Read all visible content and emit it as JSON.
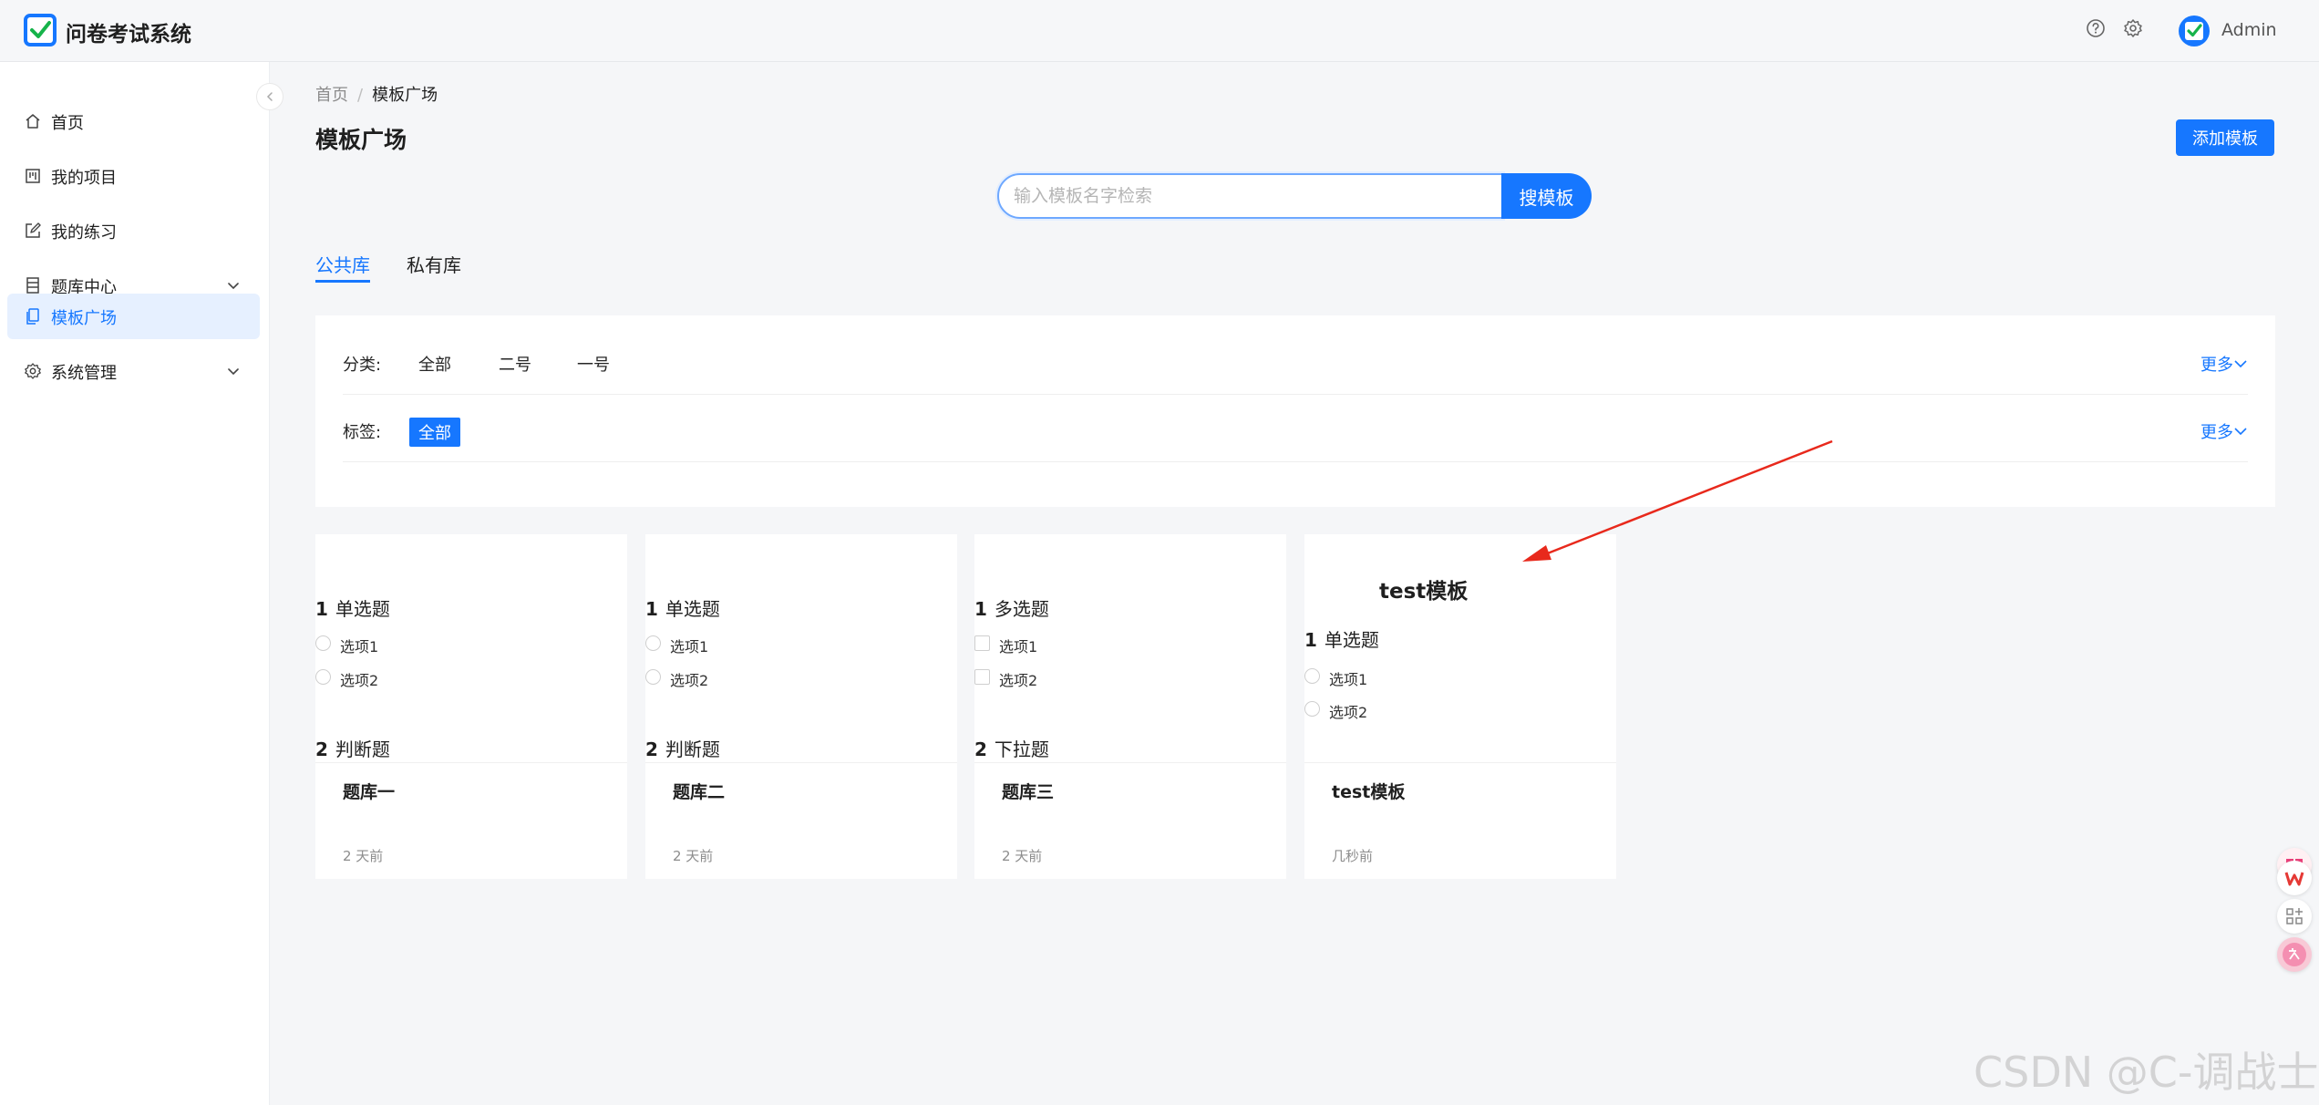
{
  "app": {
    "title": "问卷考试系统",
    "user": "Admin"
  },
  "colors": {
    "accent": "#1677ff",
    "annotation_arrow": "#e8291c"
  },
  "sidebar": {
    "items": [
      {
        "label": "首页",
        "icon": "home-icon"
      },
      {
        "label": "我的项目",
        "icon": "project-icon"
      },
      {
        "label": "我的练习",
        "icon": "edit-icon"
      },
      {
        "label": "题库中心",
        "icon": "database-icon",
        "expandable": true
      },
      {
        "label": "模板广场",
        "icon": "copy-icon",
        "active": true
      },
      {
        "label": "系统管理",
        "icon": "settings-icon",
        "expandable": true
      }
    ]
  },
  "breadcrumb": {
    "home": "首页",
    "sep": "/",
    "current": "模板广场"
  },
  "page": {
    "title": "模板广场",
    "add_button": "添加模板"
  },
  "search": {
    "placeholder": "输入模板名字检索",
    "button": "搜模板"
  },
  "tabs": [
    {
      "label": "公共库",
      "active": true
    },
    {
      "label": "私有库",
      "active": false
    }
  ],
  "filters": {
    "category": {
      "label": "分类:",
      "options": [
        "全部",
        "二号",
        "一号"
      ],
      "more": "更多"
    },
    "tag": {
      "label": "标签:",
      "options": [
        "全部"
      ],
      "more": "更多"
    }
  },
  "cards": [
    {
      "preview_title": "",
      "questions": [
        {
          "num": "1",
          "type": "单选题",
          "input": "radio",
          "options": [
            "选项1",
            "选项2"
          ]
        },
        {
          "num": "2",
          "type": "判断题",
          "input": "radio",
          "options": []
        }
      ],
      "name": "题库一",
      "time": "2 天前"
    },
    {
      "preview_title": "",
      "questions": [
        {
          "num": "1",
          "type": "单选题",
          "input": "radio",
          "options": [
            "选项1",
            "选项2"
          ]
        },
        {
          "num": "2",
          "type": "判断题",
          "input": "radio",
          "options": []
        }
      ],
      "name": "题库二",
      "time": "2 天前"
    },
    {
      "preview_title": "",
      "questions": [
        {
          "num": "1",
          "type": "多选题",
          "input": "checkbox",
          "options": [
            "选项1",
            "选项2"
          ]
        },
        {
          "num": "2",
          "type": "下拉题",
          "input": "select",
          "options": []
        }
      ],
      "name": "题库三",
      "time": "2 天前"
    },
    {
      "preview_title": "test模板",
      "questions": [
        {
          "num": "1",
          "type": "单选题",
          "input": "radio",
          "options": [
            "选项1",
            "选项2"
          ]
        }
      ],
      "name": "test模板",
      "time": "几秒前"
    }
  ],
  "watermark": "CSDN @C-调战士"
}
